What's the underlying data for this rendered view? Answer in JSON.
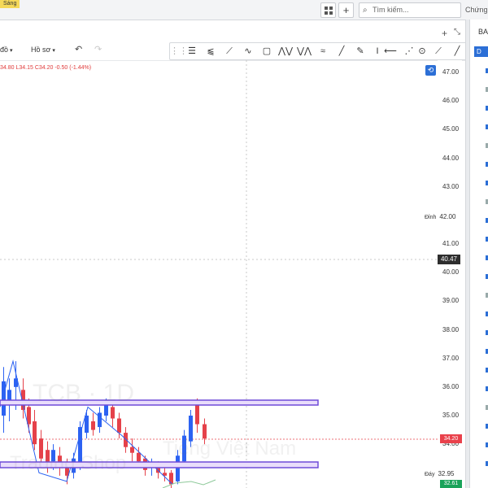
{
  "topbar": {
    "theme_label": "Sáng",
    "search_placeholder": "Tìm kiếm...",
    "right_tab_label": "Chứng",
    "grid_icon": "grid-icon",
    "add_icon": "plus-icon",
    "search_icon": "search-icon"
  },
  "toolbar": {
    "chart_type_label": "đồ",
    "profile_label": "Hồ sơ",
    "undo_icon": "undo-icon",
    "redo_icon": "redo-icon"
  },
  "drawing_tools": [
    "horizontal-lines-icon",
    "ray-icon",
    "trend-line-icon",
    "zigzag-icon",
    "rectangle-icon",
    "pattern-icon",
    "wave-pattern-icon",
    "elliott-wave-icon",
    "line-icon",
    "brush-icon",
    "text-cursor-icon",
    "horizontal-line-icon",
    "abcd-pattern-icon",
    "circle-icon",
    "ruler-icon"
  ],
  "window": {
    "add_icon": "plus-icon",
    "expand_icon": "expand-icon"
  },
  "chart": {
    "ohlc_line": "34.80 L34.15 C34.20 -0.50 (-1.44%)",
    "reset_icon": "reset-icon",
    "watermark_symbol": "TCB · 1D",
    "watermark_text": "Tiếng Việt Nam",
    "watermark_shop": "Trading Shop",
    "crosshair_price": "40.47",
    "current_price": "34.20",
    "green_price": "32.61",
    "top_label": "Đỉnh",
    "top_value": "42.00",
    "bottom_label": "Đáy",
    "bottom_value": "32.95",
    "colors": {
      "up": "#2c62f2",
      "down": "#e5414a",
      "zone_fill": "#e9ddfb",
      "zone_border": "#6f4bd8",
      "price": "#e9414b",
      "green": "#1aa35a"
    }
  },
  "axis_ticks": [
    "47.00",
    "46.00",
    "45.00",
    "44.00",
    "43.00",
    "41.00",
    "40.00",
    "39.00",
    "38.00",
    "37.00",
    "36.00",
    "35.00",
    "34.00"
  ],
  "right_panel": {
    "header": "BA",
    "tab_label": "D"
  }
}
